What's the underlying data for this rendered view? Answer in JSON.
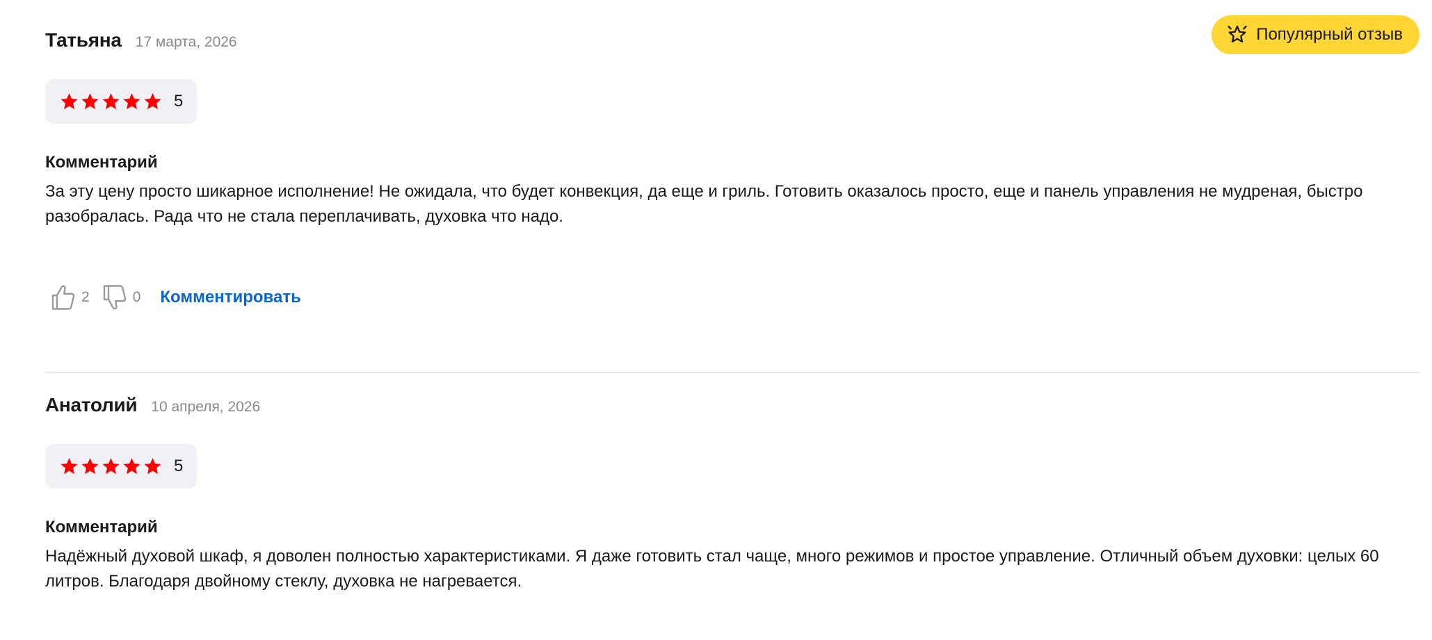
{
  "badge": {
    "label": "Популярный отзыв",
    "icon": "sparkle-star-icon",
    "color": "#ffd633"
  },
  "colors": {
    "star": "#ff0000",
    "link": "#0a66d4",
    "muted": "#8a8a8a"
  },
  "reviews": [
    {
      "author": "Татьяна",
      "date": "17 марта, 2026",
      "rating": 5,
      "rating_label": "5",
      "comment_label": "Комментарий",
      "comment": "За эту цену просто шикарное исполнение! Не ожидала, что будет конвекция, да еще и гриль. Готовить оказалось просто, еще и панель управления не мудреная, быстро разобралась. Рада что не стала переплачивать, духовка что надо.",
      "likes": "2",
      "dislikes": "0",
      "comment_action": "Комментировать"
    },
    {
      "author": "Анатолий",
      "date": "10 апреля, 2026",
      "rating": 5,
      "rating_label": "5",
      "comment_label": "Комментарий",
      "comment": "Надёжный духовой шкаф, я доволен полностью характеристиками. Я даже готовить стал чаще, много режимов и простое управление. Отличный объем духовки: целых 60 литров. Благодаря двойному стеклу, духовка не нагревается."
    }
  ]
}
